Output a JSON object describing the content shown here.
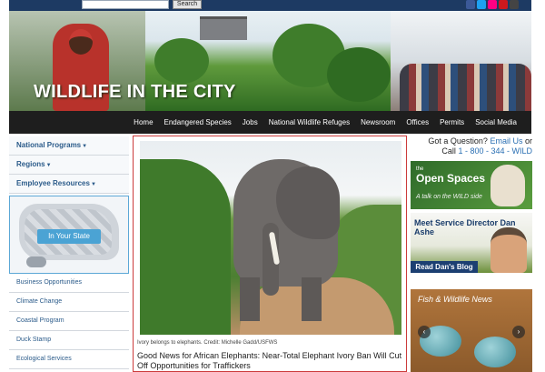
{
  "topbar": {
    "search_button": "Search",
    "social": [
      "facebook",
      "twitter",
      "flickr",
      "youtube",
      "instagram"
    ],
    "social_colors": [
      "#3b5998",
      "#1da1f2",
      "#ff0084",
      "#cc181e",
      "#444444"
    ]
  },
  "banner": {
    "title": "WILDLIFE IN THE CITY"
  },
  "nav": {
    "items": [
      "Home",
      "Endangered Species",
      "Jobs",
      "National Wildlife Refuges",
      "Newsroom",
      "Offices",
      "Permits",
      "Social Media"
    ]
  },
  "sidebar": {
    "headings": [
      "National Programs",
      "Regions",
      "Employee Resources"
    ],
    "map_button": "In Your State",
    "links": [
      "Business Opportunities",
      "Climate Change",
      "Coastal Program",
      "Duck Stamp",
      "Ecological Services"
    ]
  },
  "feature": {
    "caption": "Ivory belongs to elephants. Credit: Michelle Gadd/USFWS",
    "title": "Good News for African Elephants: Near-Total Elephant Ivory Ban Will Cut Off Opportunities for Traffickers"
  },
  "right": {
    "question_prefix": "Got a Question?",
    "email": "Email Us",
    "or": "or",
    "call": "Call",
    "phone": "1 - 800 - 344 - WILD",
    "open_spaces_small": "the",
    "open_spaces": "Open Spaces",
    "open_spaces_tag": "A talk on the WILD side",
    "meet_service": "Meet Service Director Dan Ashe",
    "read_blog": "Read Dan's Blog",
    "news_title": "Fish & Wildlife News"
  },
  "colors": {
    "accent_blue": "#2a6fb3",
    "nav_bg": "#1e1e1e",
    "feature_border": "#cc3b3b"
  }
}
